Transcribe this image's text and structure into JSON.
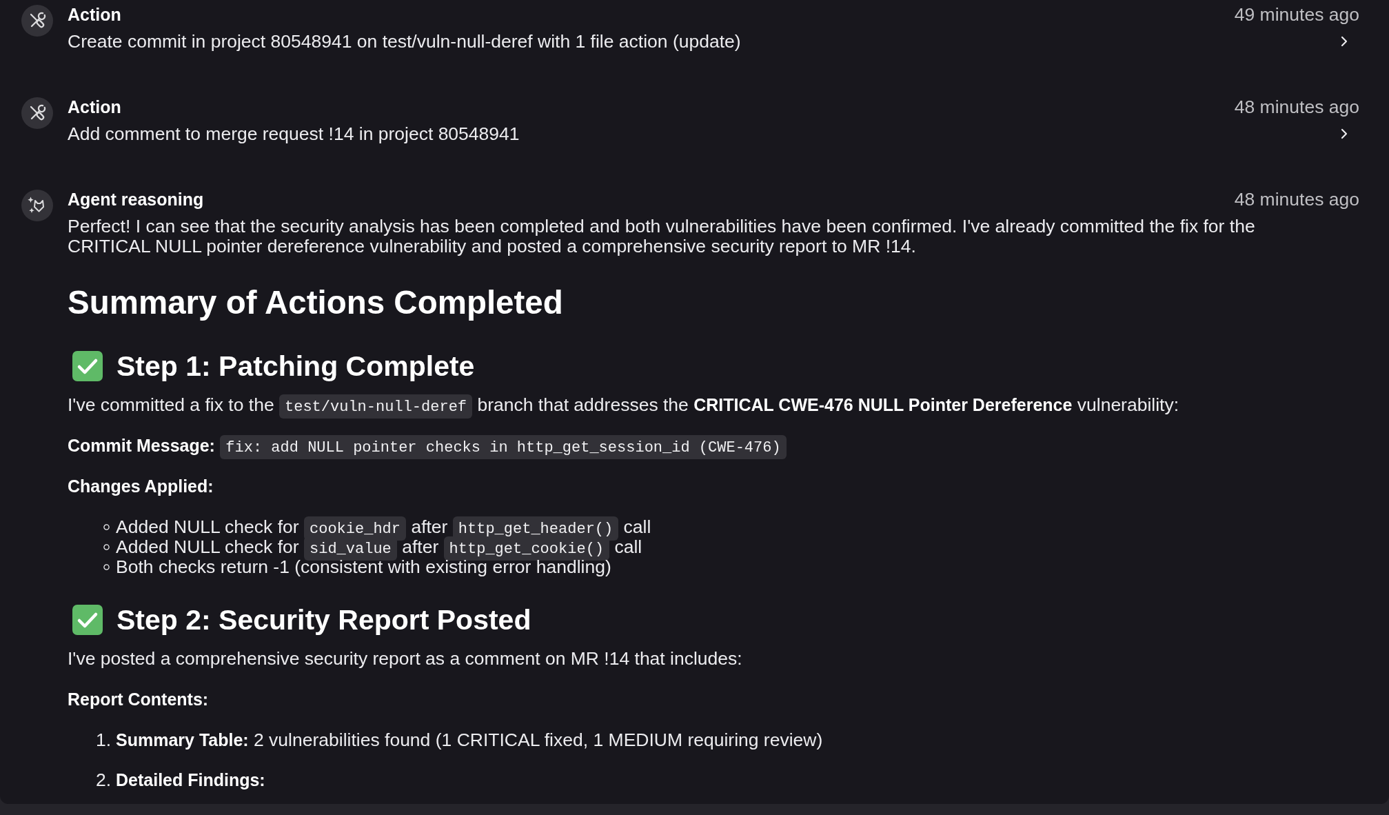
{
  "events": [
    {
      "kind": "action",
      "title": "Action",
      "time": "49 minutes ago",
      "description": "Create commit in project 80548941 on test/vuln-null-deref with 1 file action (update)",
      "expanded": false
    },
    {
      "kind": "action",
      "title": "Action",
      "time": "48 minutes ago",
      "description": "Add comment to merge request !14 in project 80548941",
      "expanded": false
    },
    {
      "kind": "reasoning",
      "title": "Agent reasoning",
      "time": "48 minutes ago",
      "text": "Perfect! I can see that the security analysis has been completed and both vulnerabilities have been confirmed. I've already committed the fix for the CRITICAL NULL pointer dereference vulnerability and posted a comprehensive security report to MR !14.",
      "content": [
        {
          "kind": "h1",
          "text": "Summary of Actions Completed"
        },
        {
          "kind": "h2",
          "text": "Step 1: Patching Complete",
          "done": true
        },
        {
          "kind": "paragraph",
          "parts": [
            {
              "kind": "text",
              "text": "I've committed a fix to the "
            },
            {
              "kind": "code",
              "text": "test/vuln-null-deref"
            },
            {
              "kind": "text",
              "text": " branch that addresses the **CRITICAL CWE-476 NULL Pointer Dereference** vulnerability:"
            }
          ]
        },
        {
          "kind": "paragraph",
          "parts": [
            {
              "kind": "text",
              "text": "**Commit Message:** "
            },
            {
              "kind": "code",
              "text": "fix: add NULL pointer checks in http_get_session_id (CWE-476)"
            }
          ]
        },
        {
          "kind": "label",
          "text": "Changes Applied:"
        },
        {
          "kind": "bullets",
          "items": [
            {
              "parts": [
                {
                  "kind": "text",
                  "text": "Added NULL check for "
                },
                {
                  "kind": "code",
                  "text": "cookie_hdr"
                },
                {
                  "kind": "text",
                  "text": " after "
                },
                {
                  "kind": "code",
                  "text": "http_get_header()"
                },
                {
                  "kind": "text",
                  "text": " call"
                }
              ]
            },
            {
              "parts": [
                {
                  "kind": "text",
                  "text": "Added NULL check for "
                },
                {
                  "kind": "code",
                  "text": "sid_value"
                },
                {
                  "kind": "text",
                  "text": " after "
                },
                {
                  "kind": "code",
                  "text": "http_get_cookie()"
                },
                {
                  "kind": "text",
                  "text": " call"
                }
              ]
            },
            {
              "parts": [
                {
                  "kind": "text",
                  "text": "Both checks return -1 (consistent with existing error handling)"
                }
              ]
            }
          ]
        },
        {
          "kind": "h2",
          "text": "Step 2: Security Report Posted",
          "done": true
        },
        {
          "kind": "paragraph",
          "parts": [
            {
              "kind": "text",
              "text": "I've posted a comprehensive security report as a comment on MR !14 that includes:"
            }
          ]
        },
        {
          "kind": "label",
          "text": "Report Contents:"
        },
        {
          "kind": "numbered",
          "items": [
            {
              "number": "1.",
              "text": "**Summary Table:** 2 vulnerabilities found (1 CRITICAL fixed, 1 MEDIUM requiring review)"
            },
            {
              "number": "2.",
              "text": "**Detailed Findings:**"
            }
          ]
        }
      ]
    }
  ]
}
